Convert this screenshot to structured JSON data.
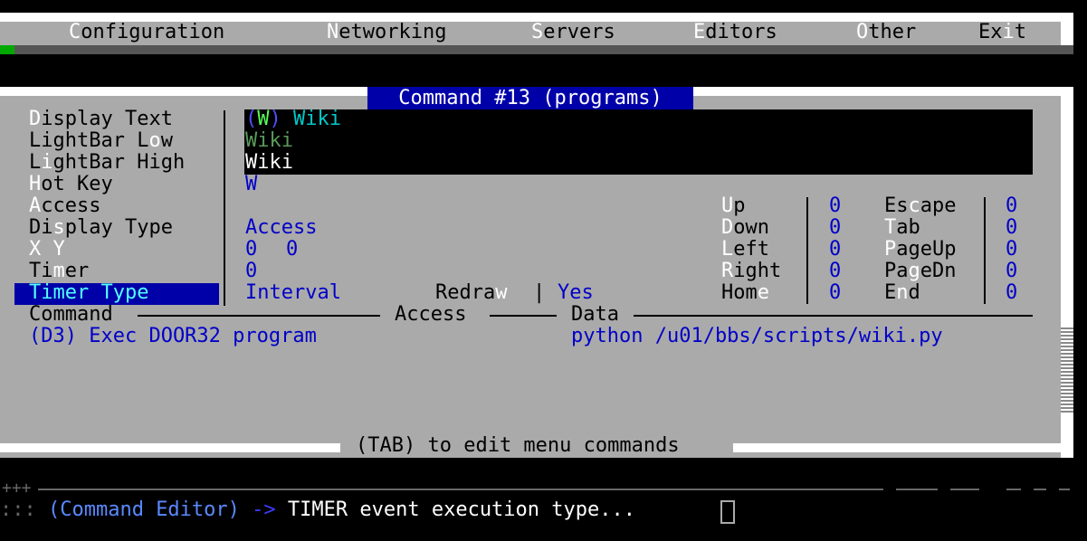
{
  "menu": [
    "Configuration",
    "Networking",
    "Servers",
    "Editors",
    "Other",
    "Exit"
  ],
  "window_title": "Command #13 (programs)",
  "fields": {
    "display_text_label": "Display Text",
    "lightbar_low_label": "LightBar Low",
    "lightbar_high_label": "LightBar High",
    "hot_key_label": "Hot Key",
    "access_label": "Access",
    "display_type_label": "Display Type",
    "xy_label": "X Y",
    "timer_label": "Timer",
    "timer_type_label": "Timer Type",
    "display_text_hotkey": "(W)",
    "display_text_value": "Wiki",
    "lightbar_low_value": "Wiki",
    "lightbar_high_value": "Wiki",
    "hot_key_value": "W",
    "access_value": "",
    "display_type_value": "Access",
    "x_value": "0",
    "y_value": "0",
    "timer_value": "0",
    "timer_type_value": "Interval",
    "redraw_label": "Redraw",
    "redraw_sep": "|",
    "redraw_value": "Yes"
  },
  "keys": [
    {
      "label": "Up",
      "value": "0"
    },
    {
      "label": "Down",
      "value": "0"
    },
    {
      "label": "Left",
      "value": "0"
    },
    {
      "label": "Right",
      "value": "0"
    },
    {
      "label": "Home",
      "value": "0"
    },
    {
      "label": "Escape",
      "value": "0"
    },
    {
      "label": "Tab",
      "value": "0"
    },
    {
      "label": "PageUp",
      "value": "0"
    },
    {
      "label": "PageDn",
      "value": "0"
    },
    {
      "label": "End",
      "value": "0"
    }
  ],
  "command_table": {
    "headers": [
      "Command",
      "Access",
      "Data"
    ],
    "row": {
      "command": "(D3) Exec DOOR32 program",
      "access": "",
      "data": "python /u01/bbs/scripts/wiki.py"
    }
  },
  "footer_hint": "(TAB) to edit menu commands",
  "status": {
    "prefix": "::: ",
    "editor": "(Command Editor)",
    "arrow": " -> ",
    "message": "TIMER event execution type..."
  }
}
